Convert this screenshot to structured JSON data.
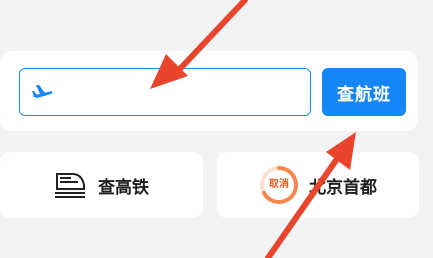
{
  "search": {
    "placeholder": "",
    "button_label": "查航班"
  },
  "quick_actions": {
    "train_label": "查高铁",
    "history_badge": "取消",
    "history_label": "北京首都"
  },
  "colors": {
    "accent": "#1486f7",
    "badge": "#f05a1e",
    "annotation_arrow": "#e8452c"
  },
  "icons": [
    "plane-icon",
    "train-icon",
    "cancel-badge-icon",
    "annotation-arrow-icon"
  ]
}
